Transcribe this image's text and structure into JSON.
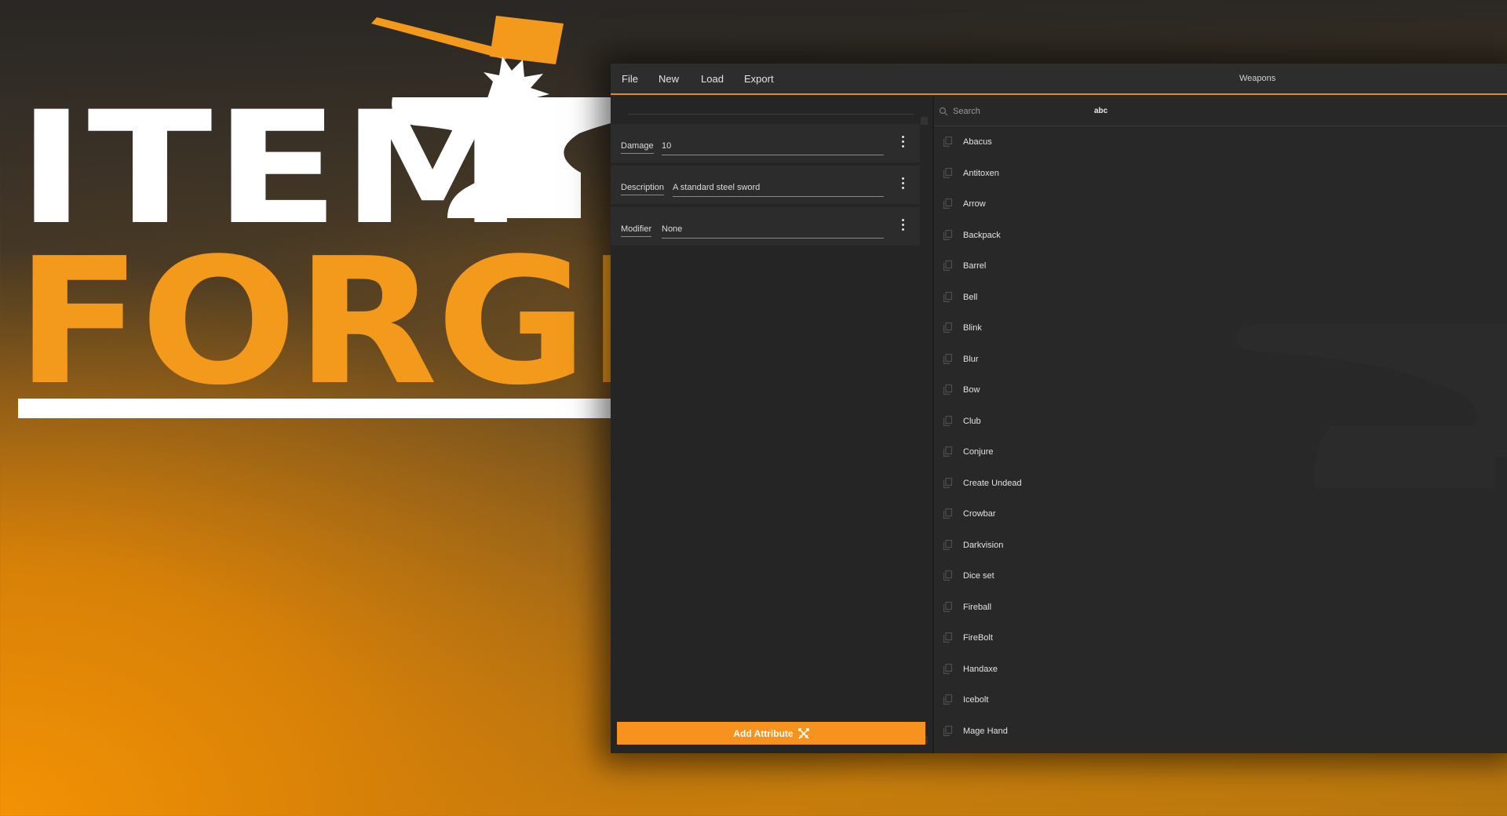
{
  "logo": {
    "line1": "ITEM",
    "line2": "FORGE"
  },
  "colors": {
    "accent": "#f6921e",
    "background_dark": "#252525",
    "panel": "#2c2c2c"
  },
  "menu": {
    "items": [
      "File",
      "New",
      "Load",
      "Export"
    ]
  },
  "window": {
    "title": "Weapons"
  },
  "attributes": [
    {
      "name": "Damage",
      "value": "10"
    },
    {
      "name": "Description",
      "value": "A standard steel sword"
    },
    {
      "name": "Modifier",
      "value": "None"
    }
  ],
  "add_button": {
    "label": "Add Attribute",
    "icon": "crossed-swords-icon"
  },
  "search": {
    "placeholder": "Search",
    "sort_toggle": "abc"
  },
  "items": [
    "Abacus",
    "Antitoxen",
    "Arrow",
    "Backpack",
    "Barrel",
    "Bell",
    "Blink",
    "Blur",
    "Bow",
    "Club",
    "Conjure",
    "Create Undead",
    "Crowbar",
    "Darkvision",
    "Dice set",
    "Fireball",
    "FireBolt",
    "Handaxe",
    "Icebolt",
    "Mage Hand"
  ]
}
